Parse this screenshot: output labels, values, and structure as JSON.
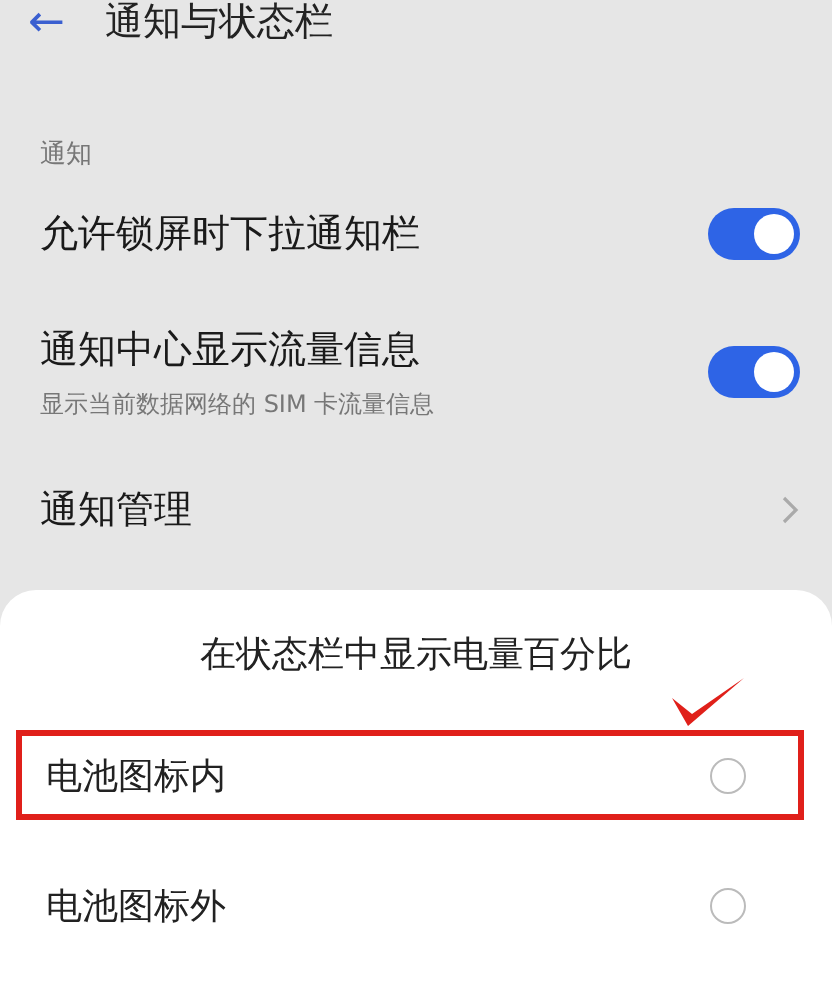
{
  "header": {
    "back": "←",
    "title": "通知与状态栏"
  },
  "section": {
    "label": "通知"
  },
  "rows": [
    {
      "kind": "toggle",
      "title": "允许锁屏时下拉通知栏",
      "on": true
    },
    {
      "kind": "toggle",
      "title": "通知中心显示流量信息",
      "subtitle": "显示当前数据网络的 SIM 卡流量信息",
      "on": true
    },
    {
      "kind": "link",
      "title": "通知管理"
    }
  ],
  "sheet": {
    "title": "在状态栏中显示电量百分比",
    "options": [
      {
        "label": "电池图标内",
        "selected": false,
        "highlighted": true
      },
      {
        "label": "电池图标外",
        "selected": false,
        "highlighted": false
      }
    ]
  }
}
